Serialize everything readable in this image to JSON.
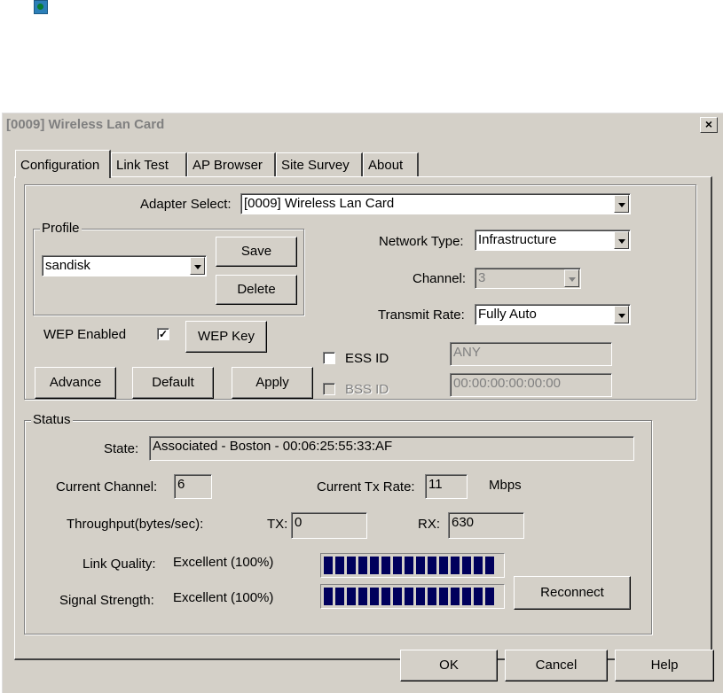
{
  "window": {
    "title": "[0009] Wireless Lan Card",
    "close_glyph": "×"
  },
  "tabs": [
    "Configuration",
    "Link Test",
    "AP Browser",
    "Site Survey",
    "About"
  ],
  "config": {
    "adapter_label": "Adapter Select:",
    "adapter_value": "[0009] Wireless Lan Card",
    "profile_legend": "Profile",
    "profile_value": "sandisk",
    "save_label": "Save",
    "delete_label": "Delete",
    "network_type_label": "Network Type:",
    "network_type_value": "Infrastructure",
    "channel_label": "Channel:",
    "channel_value": "3",
    "transmit_rate_label": "Transmit Rate:",
    "transmit_rate_value": "Fully Auto",
    "wep_enabled_label": "WEP Enabled",
    "wep_check": "✓",
    "wep_key_label": "WEP Key",
    "ess_label": "ESS ID",
    "ess_value": "ANY",
    "bss_label": "BSS ID",
    "bss_value": "00:00:00:00:00:00",
    "advance_label": "Advance",
    "default_label": "Default",
    "apply_label": "Apply"
  },
  "status": {
    "legend": "Status",
    "state_label": "State:",
    "state_value": "Associated - Boston - 00:06:25:55:33:AF",
    "current_channel_label": "Current Channel:",
    "current_channel_value": "6",
    "tx_rate_label": "Current Tx Rate:",
    "tx_rate_value": "11",
    "tx_rate_unit": "Mbps",
    "throughput_label": "Throughput(bytes/sec):",
    "tx_label": "TX:",
    "tx_value": "0",
    "rx_label": "RX:",
    "rx_value": "630",
    "link_quality_label": "Link Quality:",
    "link_quality_value": "Excellent (100%)",
    "link_quality_percent": 100,
    "signal_label": "Signal Strength:",
    "signal_value": "Excellent (100%)",
    "signal_percent": 100,
    "reconnect_label": "Reconnect"
  },
  "footer": {
    "ok_label": "OK",
    "cancel_label": "Cancel",
    "help_label": "Help"
  }
}
